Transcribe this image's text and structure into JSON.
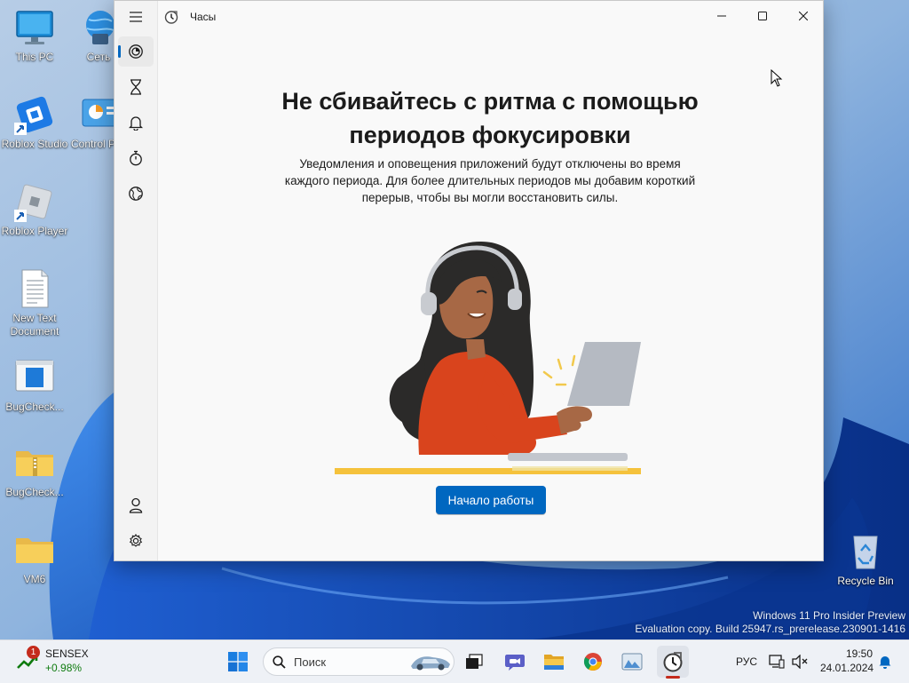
{
  "desktop": {
    "icons": [
      {
        "label": "This PC"
      },
      {
        "label": "Сеть"
      },
      {
        "label": "Roblox Studio"
      },
      {
        "label": "Control P"
      },
      {
        "label": "Roblox Player"
      },
      {
        "label": "New Text Document"
      },
      {
        "label": "BugCheck..."
      },
      {
        "label": "BugCheck..."
      },
      {
        "label": "VM6"
      },
      {
        "label": "Recycle Bin"
      }
    ],
    "watermark": {
      "line1": "Windows 11 Pro Insider Preview",
      "line2": "Evaluation copy. Build 25947.rs_prerelease.230901-1416"
    }
  },
  "window": {
    "title": "Часы",
    "nav": [
      {
        "icon": "focus-sessions-icon",
        "active": true
      },
      {
        "icon": "timer-icon",
        "active": false
      },
      {
        "icon": "alarm-icon",
        "active": false
      },
      {
        "icon": "stopwatch-icon",
        "active": false
      },
      {
        "icon": "world-clock-icon",
        "active": false
      }
    ],
    "headline": {
      "line1": "Не сбивайтесь с ритма с помощью",
      "line2": "периодов фокусировки"
    },
    "description": {
      "line1": "Уведомления и оповещения приложений будут отключены во время",
      "line2": "каждого периода. Для более длительных периодов мы добавим короткий",
      "line3": "перерыв, чтобы вы могли восстановить силы."
    },
    "start_button": "Начало работы"
  },
  "taskbar": {
    "widget": {
      "name": "SENSEX",
      "change": "+0.98%",
      "badge": "1"
    },
    "search_placeholder": "Поиск",
    "language": "РУС",
    "time": "19:50",
    "date": "24.01.2024"
  },
  "colors": {
    "accent": "#0067c0",
    "window_bg": "#f9f9f9",
    "taskbar_bg": "#eef1f6",
    "widget_green": "#0f7b0f"
  }
}
